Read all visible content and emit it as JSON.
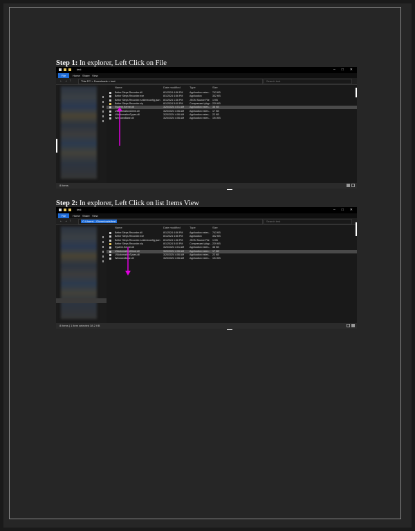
{
  "steps": [
    {
      "title_bold": "Step 1:",
      "title_text": " In explorer, Left Click on File",
      "window": {
        "title": "test",
        "ribbon_tabs": [
          "File",
          "Home",
          "Share",
          "View"
        ],
        "address": "This PC  >  Downloads  >  test",
        "search_placeholder": "Search test",
        "columns": [
          "Name",
          "Date modified",
          "Type",
          "Size"
        ],
        "files": [
          {
            "name": "Better.Steps.Recorder.dll",
            "date": "8/1/2024 4:56 PM",
            "type": "Application exten...",
            "size": "743 KB",
            "icon": "dll"
          },
          {
            "name": "Better Steps Recorder.exe",
            "date": "8/1/2024 4:56 PM",
            "type": "Application",
            "size": "302 KB",
            "icon": "exe"
          },
          {
            "name": "Better Steps Recorder.runtimeconfig.json",
            "date": "8/1/2024 1:36 PM",
            "type": "JSON Source File",
            "size": "1 KB",
            "icon": "json"
          },
          {
            "name": "Better Steps Recorder.zip",
            "date": "8/1/2024 5:00 PM",
            "type": "Compressed (zipp...",
            "size": "229 KB",
            "icon": "zip"
          },
          {
            "name": "System.Kernel.dll",
            "date": "3/20/2024 4:01 AM",
            "type": "Application exten...",
            "size": "38 KB",
            "icon": "dll"
          },
          {
            "name": "UIAutomationClient.dll",
            "date": "3/20/2024 4:06 AM",
            "type": "Application exten...",
            "size": "17 KB",
            "icon": "dll"
          },
          {
            "name": "UIAutomationTypes.dll",
            "date": "3/20/2024 4:06 AM",
            "type": "Application exten...",
            "size": "22 KB",
            "icon": "dll"
          },
          {
            "name": "WindowsBase.dll",
            "date": "3/20/2024 4:06 AM",
            "type": "Application exten...",
            "size": "194 KB",
            "icon": "dll"
          }
        ],
        "selected_row": 4,
        "status": "8 items"
      }
    },
    {
      "title_bold": "Step 2:",
      "title_text": " In explorer, Left Click on list Items View",
      "window": {
        "title": "test",
        "ribbon_tabs": [
          "File",
          "Home",
          "Share",
          "View"
        ],
        "address_highlight": "C:\\Users\\...\\Downloads\\test",
        "search_placeholder": "Search test",
        "columns": [
          "Name",
          "Date modified",
          "Type",
          "Size"
        ],
        "files": [
          {
            "name": "Better.Steps.Recorder.dll",
            "date": "8/1/2024 4:56 PM",
            "type": "Application exten...",
            "size": "743 KB",
            "icon": "dll"
          },
          {
            "name": "Better Steps Recorder.exe",
            "date": "8/1/2024 4:56 PM",
            "type": "Application",
            "size": "302 KB",
            "icon": "exe"
          },
          {
            "name": "Better Steps Recorder.runtimeconfig.json",
            "date": "8/1/2024 1:36 PM",
            "type": "JSON Source File",
            "size": "1 KB",
            "icon": "json"
          },
          {
            "name": "Better Steps Recorder.zip",
            "date": "8/1/2024 5:00 PM",
            "type": "Compressed (zipp...",
            "size": "229 KB",
            "icon": "zip"
          },
          {
            "name": "System.Kernel.dll",
            "date": "3/20/2024 4:01 AM",
            "type": "Application exten...",
            "size": "38 KB",
            "icon": "dll"
          },
          {
            "name": "UIAutomationClient.dll",
            "date": "3/20/2024 4:06 AM",
            "type": "Application exten...",
            "size": "17 KB",
            "icon": "dll"
          },
          {
            "name": "UIAutomationTypes.dll",
            "date": "3/20/2024 4:06 AM",
            "type": "Application exten...",
            "size": "22 KB",
            "icon": "dll"
          },
          {
            "name": "WindowsBase.dll",
            "date": "3/20/2024 4:06 AM",
            "type": "Application exten...",
            "size": "194 KB",
            "icon": "dll"
          }
        ],
        "selected_row": 5,
        "status": "8 items  |  1 item selected  38.2 KB"
      }
    }
  ],
  "colors": {
    "page": "#262626",
    "accent": "#1e6bd6",
    "arrow": "#e000e0"
  }
}
